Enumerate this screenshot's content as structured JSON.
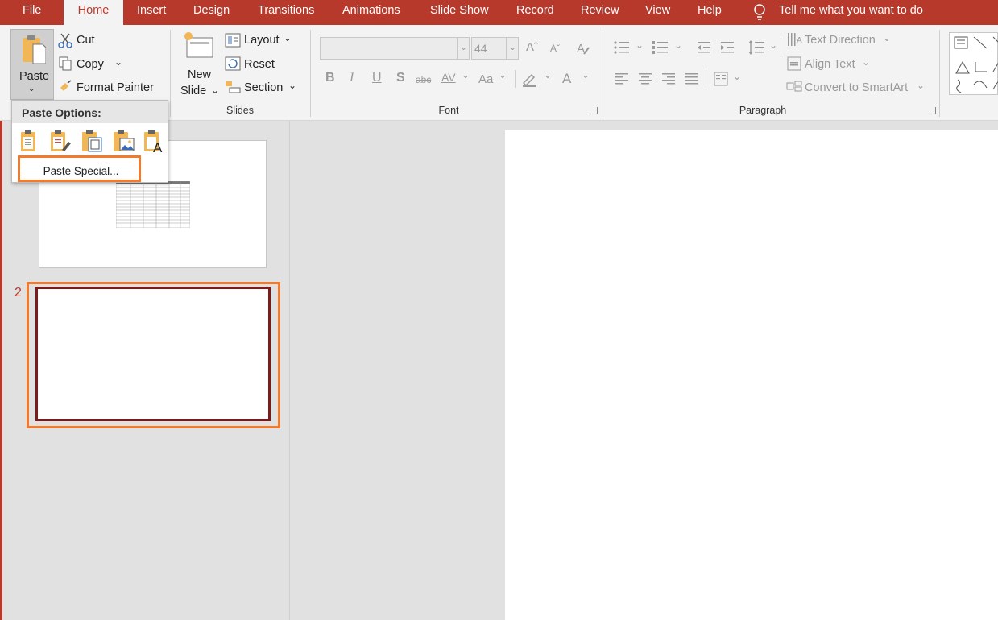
{
  "tabs": [
    "File",
    "Home",
    "Insert",
    "Design",
    "Transitions",
    "Animations",
    "Slide Show",
    "Record",
    "Review",
    "View",
    "Help"
  ],
  "tell_me": "Tell me what you want to do",
  "clipboard": {
    "paste": "Paste",
    "cut": "Cut",
    "copy": "Copy",
    "format_painter": "Format Painter"
  },
  "slides_group": {
    "new_slide_line1": "New",
    "new_slide_line2": "Slide",
    "layout": "Layout",
    "reset": "Reset",
    "section": "Section",
    "label": "Slides"
  },
  "font_group": {
    "font_size": "44",
    "label": "Font",
    "bold": "B",
    "italic": "I",
    "underline": "U",
    "shadow": "S",
    "strikethrough": "abc",
    "char_spacing": "AV",
    "change_case": "Aa",
    "font_color": "A"
  },
  "paragraph_group": {
    "text_direction": "Text Direction",
    "align_text": "Align Text",
    "convert_smartart": "Convert to SmartArt",
    "label": "Paragraph"
  },
  "paste_menu": {
    "title": "Paste Options:",
    "paste_special": "Paste Special..."
  },
  "thumbnails": {
    "slide2_number": "2"
  },
  "colors": {
    "accent": "#b7392b",
    "highlight": "#f37a2b",
    "thumb_border": "#7d1a1a"
  }
}
